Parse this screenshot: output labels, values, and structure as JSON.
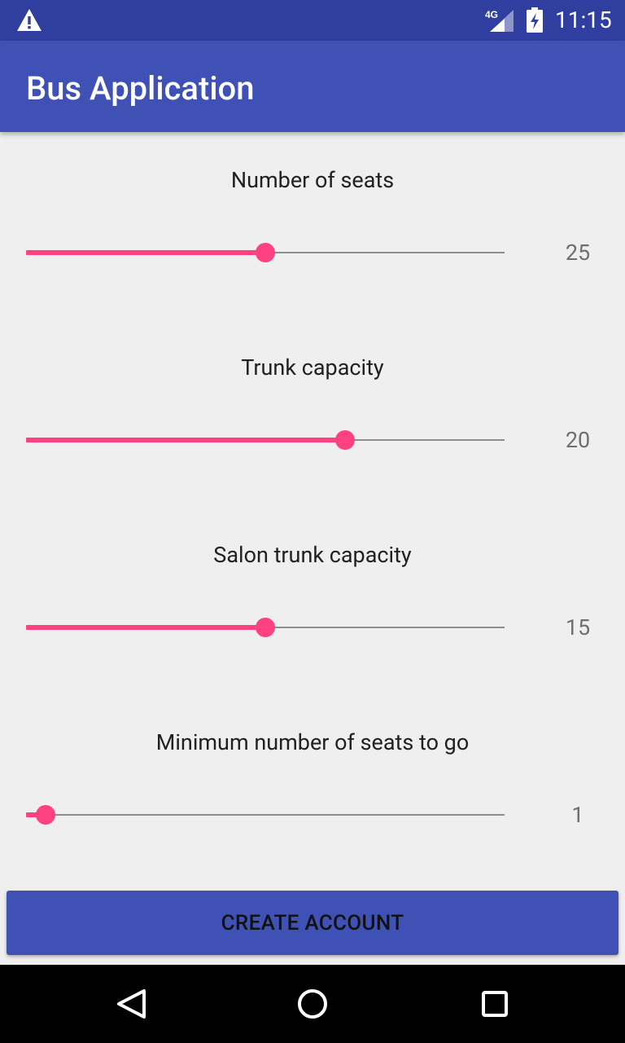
{
  "status_bar": {
    "time": "11:15",
    "network": "4G",
    "icons": [
      "warning-icon",
      "signal-4g-icon",
      "battery-charging-icon"
    ]
  },
  "app_bar": {
    "title": "Bus Application"
  },
  "sliders": [
    {
      "label": "Number of seats",
      "value": "25",
      "fraction": 0.5
    },
    {
      "label": "Trunk capacity",
      "value": "20",
      "fraction": 0.667
    },
    {
      "label": "Salon trunk capacity",
      "value": "15",
      "fraction": 0.5
    },
    {
      "label": "Minimum number of seats to go",
      "value": "1",
      "fraction": 0.04
    }
  ],
  "actions": {
    "create_label": "CREATE ACCOUNT"
  },
  "nav_bar": {
    "icons": [
      "back-icon",
      "home-icon",
      "recents-icon"
    ]
  },
  "colors": {
    "status_bar": "#303f9f",
    "primary": "#3f51b5",
    "accent": "#ff4081",
    "background": "#efefef"
  }
}
